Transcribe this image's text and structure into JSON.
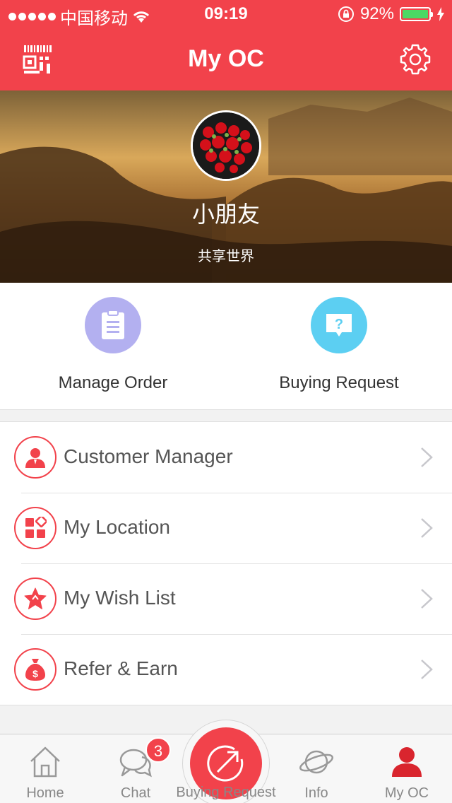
{
  "status": {
    "carrier": "中国移动",
    "time": "09:19",
    "battery": "92%",
    "battery_level": 0.92
  },
  "navbar": {
    "title": "My OC",
    "left_icon": "qr-scan-icon",
    "right_icon": "gear-icon"
  },
  "profile": {
    "name": "小朋友",
    "motto": "共享世界"
  },
  "quick_actions": [
    {
      "label": "Manage Order",
      "icon": "clipboard-icon",
      "color": "#b3b0f0"
    },
    {
      "label": "Buying Request",
      "icon": "question-bubble-icon",
      "color": "#5ccff2"
    }
  ],
  "menu": [
    {
      "label": "Customer Manager",
      "icon": "person-icon"
    },
    {
      "label": "My Location",
      "icon": "blocks-icon"
    },
    {
      "label": "My Wish List",
      "icon": "star-icon"
    },
    {
      "label": "Refer & Earn",
      "icon": "money-bag-icon"
    }
  ],
  "tabs": [
    {
      "label": "Home",
      "icon": "home-icon"
    },
    {
      "label": "Chat",
      "icon": "chat-icon",
      "badge": "3"
    },
    {
      "label": "Buying Request",
      "icon": "arrow-circle-icon"
    },
    {
      "label": "Info",
      "icon": "planet-icon"
    },
    {
      "label": "My OC",
      "icon": "person-icon"
    }
  ],
  "colors": {
    "accent": "#f2424b",
    "battery_green": "#4cd964"
  }
}
